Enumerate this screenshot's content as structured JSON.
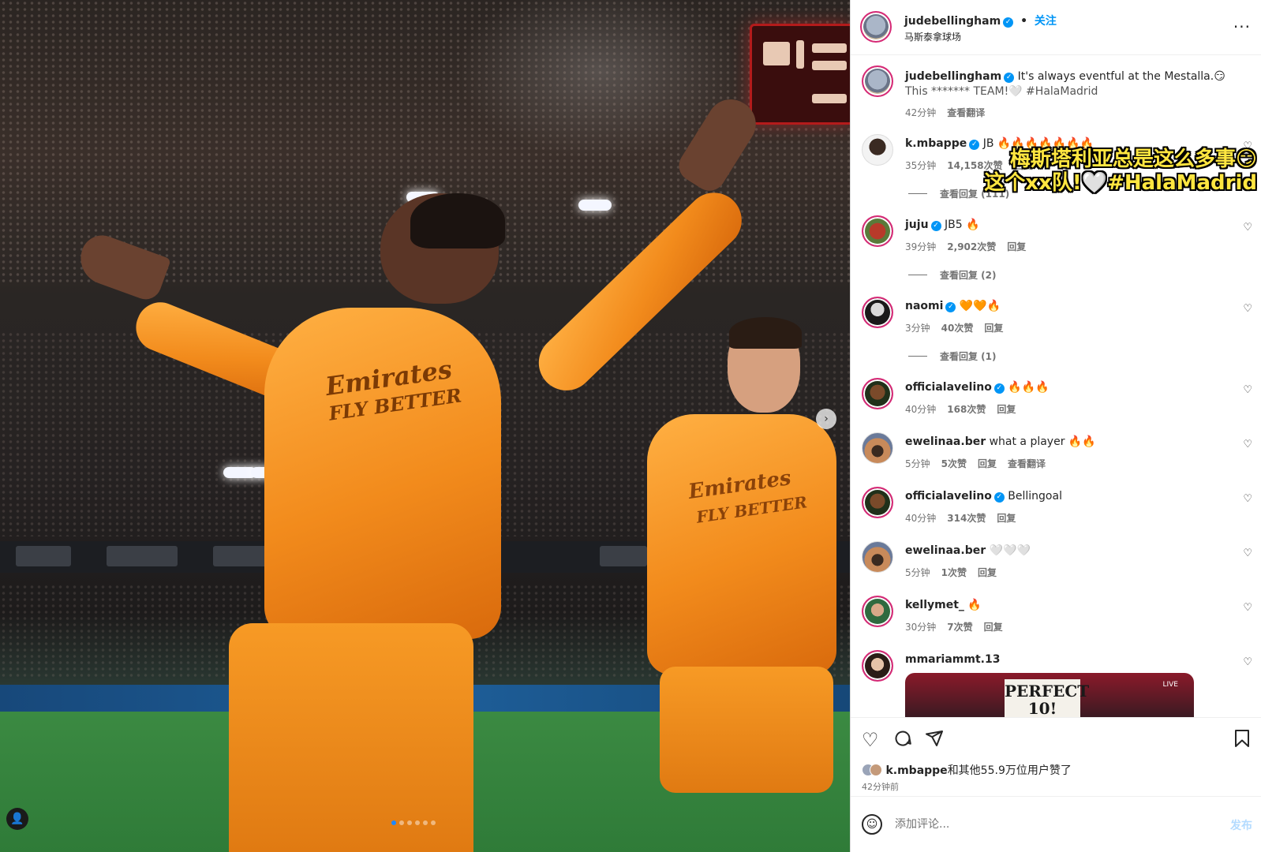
{
  "photo": {
    "jersey_text_line1": "Emirates",
    "jersey_text_line2": "FLY BETTER",
    "next_icon": "chevron-right-icon",
    "page_dots": 6,
    "active_dot": 0
  },
  "header": {
    "username": "judebellingham",
    "separator": "•",
    "follow_label": "关注",
    "location": "马斯泰拿球场",
    "more_icon": "···"
  },
  "caption": {
    "username": "judebellingham",
    "text_line1": "It's always eventful at the Mestalla.😏",
    "text_line2": "This ******* TEAM!🤍 #HalaMadrid",
    "time": "42分钟",
    "translate": "查看翻译"
  },
  "overlay_subtitle": {
    "line1": "梅斯塔利亚总是这么多事😏",
    "line2": "这个xx队!🤍#HalaMadrid"
  },
  "comments": [
    {
      "username": "k.mbappe",
      "verified": true,
      "text": "JB 🔥🔥🔥🔥🔥🔥🔥",
      "time": "35分钟",
      "likes": "14,158次赞",
      "reply": "回复",
      "view_replies": "查看回复 (111)"
    },
    {
      "username": "juju",
      "verified": true,
      "text": "JB5 🔥",
      "time": "39分钟",
      "likes": "2,902次赞",
      "reply": "回复",
      "view_replies": "查看回复 (2)"
    },
    {
      "username": "naomi",
      "verified": true,
      "text": "🧡🧡🔥",
      "time": "3分钟",
      "likes": "40次赞",
      "reply": "回复",
      "view_replies": "查看回复 (1)"
    },
    {
      "username": "officialavelino",
      "verified": true,
      "text": "🔥🔥🔥",
      "time": "40分钟",
      "likes": "168次赞",
      "reply": "回复"
    },
    {
      "username": "ewelinaa.ber",
      "verified": false,
      "text": "what a player 🔥🔥",
      "time": "5分钟",
      "likes": "5次赞",
      "reply": "回复",
      "translate": "查看翻译"
    },
    {
      "username": "officialavelino",
      "verified": true,
      "text": "Bellingoal",
      "time": "40分钟",
      "likes": "314次赞",
      "reply": "回复"
    },
    {
      "username": "ewelinaa.ber",
      "verified": false,
      "text": "🤍🤍🤍",
      "time": "5分钟",
      "likes": "1次赞",
      "reply": "回复"
    },
    {
      "username": "kellymet_",
      "verified": false,
      "text": "🔥",
      "time": "30分钟",
      "likes": "7次赞",
      "reply": "回复"
    },
    {
      "username": "mmariammt.13",
      "verified": false,
      "text": "",
      "thumb_sign": "PERFECT 10!",
      "thumb_badge": "LIVE"
    }
  ],
  "actions": {
    "like_icon": "heart-icon",
    "comment_icon": "comment-icon",
    "share_icon": "send-icon",
    "save_icon": "bookmark-icon",
    "liked_by_user": "k.mbappe",
    "liked_by_rest": "和其他55.9万位用户赞了",
    "posted_ago": "42分钟前"
  },
  "add_comment": {
    "placeholder": "添加评论...",
    "post_label": "发布"
  },
  "colors": {
    "accent": "#0095f6",
    "jersey": "#f28b1c",
    "subtitle": "#ffe640"
  }
}
